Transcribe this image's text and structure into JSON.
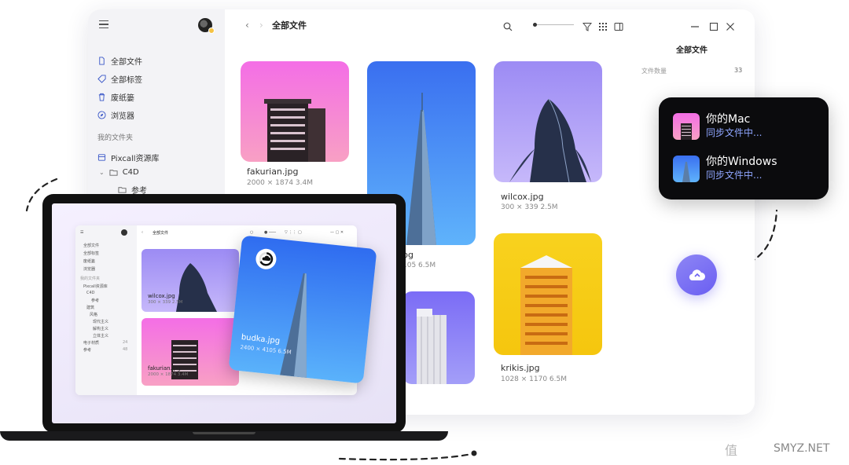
{
  "window": {
    "title": "全部文件",
    "sidebar": {
      "items": [
        "全部文件",
        "全部标签",
        "废纸篓",
        "浏览器"
      ],
      "section_label": "我的文件夹",
      "folders": [
        "Pixcall资源库",
        "C4D",
        "参考"
      ]
    },
    "files": [
      {
        "name": "fakurian.jpg",
        "meta": "2000 × 1874  3.4M"
      },
      {
        "name": "pg",
        "meta": "105  6.5M"
      },
      {
        "name": "wilcox.jpg",
        "meta": "300 × 339  2.5M"
      },
      {
        "name": "krikis.jpg",
        "meta": "1028 × 1170  6.5M"
      }
    ],
    "info_panel": {
      "title": "全部文件",
      "count_label": "文件数量",
      "count_value": "33"
    }
  },
  "sync_popup": {
    "devices": [
      {
        "name": "你的Mac",
        "status": "同步文件中..."
      },
      {
        "name": "你的Windows",
        "status": "同步文件中..."
      }
    ]
  },
  "laptop": {
    "title": "全部文件",
    "sidebar": [
      "全部文件",
      "全部标签",
      "废纸篓",
      "浏览器",
      "我的文件夹",
      "Pixcall资源库",
      "C4D",
      "参考",
      "建筑",
      "风格",
      "现代主义",
      "解构主义",
      "立体主义",
      "电子材质",
      "参考"
    ],
    "sidebar_counts": [
      "24",
      "48"
    ],
    "cards": [
      {
        "name": "wilcox.jpg",
        "meta": "300 × 339  2.5M"
      },
      {
        "name": "fakurian.jpg",
        "meta": "2000 × 1874  3.4M"
      }
    ],
    "floating_card": {
      "name": "budka.jpg",
      "meta": "2400 × 4105  6.5M"
    }
  },
  "watermark": {
    "icon_text": "值",
    "site": "SMYZ.NET"
  },
  "colors": {
    "accent": "#6a5ef2",
    "sync_status": "#8fa6ff",
    "popup_bg": "#0b0b0d"
  }
}
